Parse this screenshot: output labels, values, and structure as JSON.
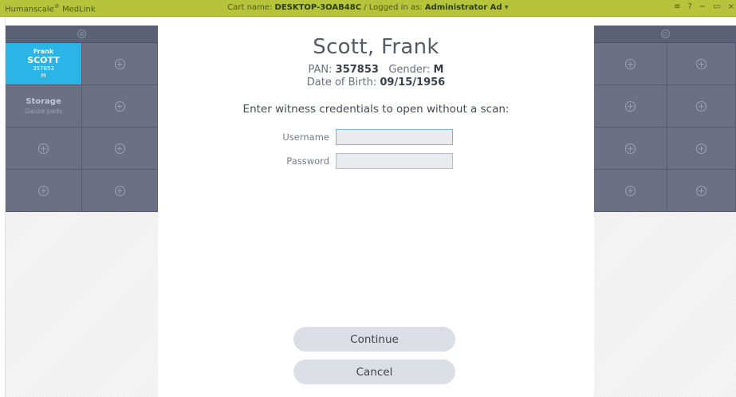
{
  "titlebar": {
    "brand": "Humanscale",
    "brand_reg": "®",
    "brand_product": " MedLink",
    "cart_label": "Cart name: ",
    "cart_name": "DESKTOP-3OAB48C",
    "separator": " / ",
    "logged_label": "Logged in as: ",
    "logged_user": "Administrator Ad",
    "dropdown_glyph": " ▾",
    "menu_glyph": "≡",
    "help_glyph": "?",
    "minimize_glyph": "−",
    "restore_glyph": "▭",
    "close_glyph": "×"
  },
  "left_panel": {
    "head_icon": "⊗",
    "patient_cell": {
      "first_name": "Frank",
      "last_name": "SCOTT",
      "pan": "357853",
      "gender": "M"
    },
    "storage_cell": {
      "title": "Storage",
      "subtitle": "Gauze pads"
    },
    "add_glyph": "+"
  },
  "right_panel": {
    "head_icon": "⊙",
    "add_glyph": "+"
  },
  "dialog": {
    "name": "Scott, Frank",
    "pan_label": "PAN: ",
    "pan_value": "357853",
    "gender_label": "Gender: ",
    "gender_value": "M",
    "dob_label": "Date of Birth: ",
    "dob_value": "09/15/1956",
    "instruction": "Enter witness credentials to open without a scan:",
    "username_label": "Username",
    "username_value": "",
    "password_label": "Password",
    "password_value": "",
    "continue_label": "Continue",
    "cancel_label": "Cancel"
  },
  "colors": {
    "titlebar": "#b5c43a",
    "drawer_cell": "#6b7085",
    "patient_cell": "#2bb4e6",
    "button": "#dcdee6"
  }
}
